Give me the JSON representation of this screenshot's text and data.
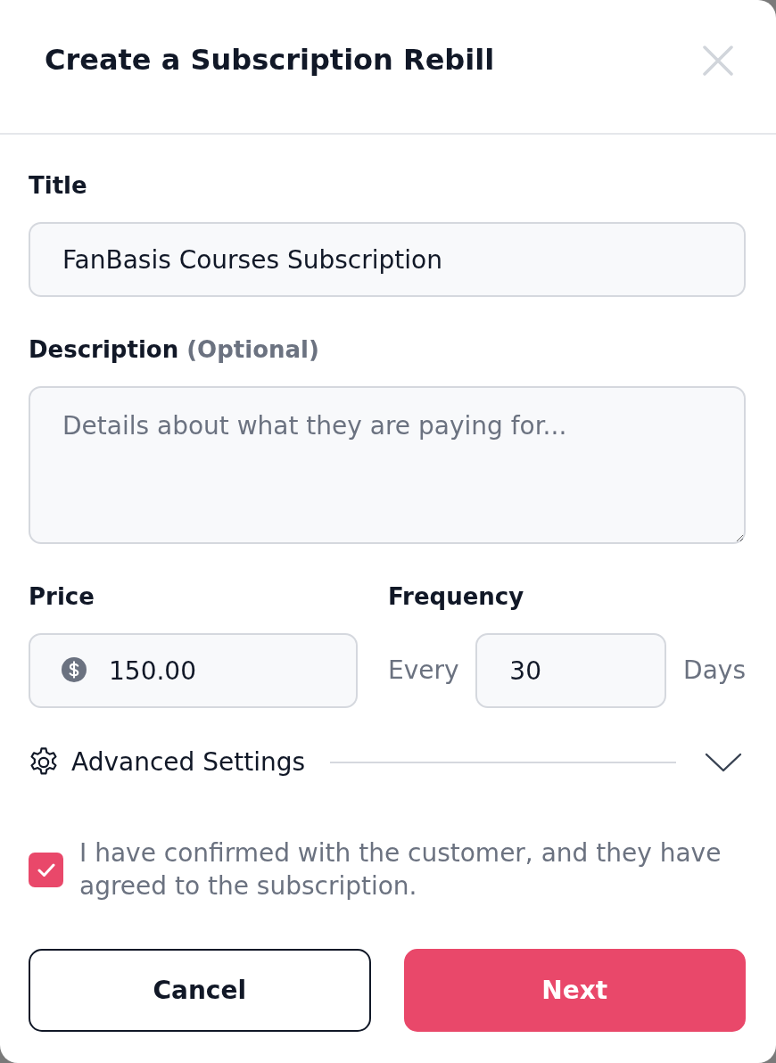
{
  "dialog": {
    "title": "Create a Subscription Rebill"
  },
  "title_field": {
    "label": "Title",
    "value": "FanBasis Courses Subscription"
  },
  "description_field": {
    "label": "Description",
    "optional_note": "(Optional)",
    "placeholder": "Details about what they are paying for..."
  },
  "price_field": {
    "label": "Price",
    "value": "150.00"
  },
  "frequency_field": {
    "label": "Frequency",
    "prefix": "Every",
    "value": "30",
    "suffix": "Days"
  },
  "advanced_settings": {
    "label": "Advanced Settings",
    "expanded": false
  },
  "confirmation": {
    "checked": true,
    "text": "I have confirmed with the customer, and they have agreed to the subscription."
  },
  "buttons": [
    {
      "label": "Cancel",
      "kind": "secondary"
    },
    {
      "label": "Next",
      "kind": "primary"
    }
  ]
}
